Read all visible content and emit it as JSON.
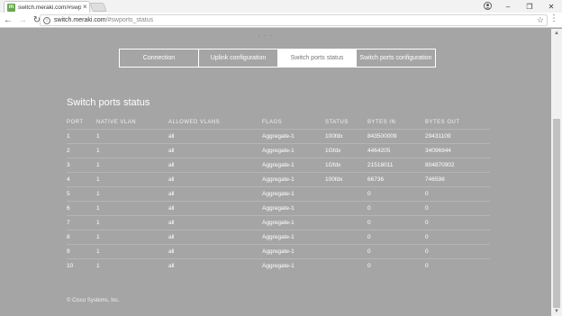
{
  "browser": {
    "tab_title": "switch.meraki.com/#swp",
    "tab_close": "×",
    "favicon_letter": "m",
    "url_host": "switch.meraki.com",
    "url_path": "/#swports_status",
    "window_controls": [
      "–",
      "❐",
      "✕"
    ]
  },
  "page": {
    "dots": "· · ·",
    "tabs": [
      {
        "label": "Connection",
        "active": false
      },
      {
        "label": "Uplink configuration",
        "active": false
      },
      {
        "label": "Switch ports status",
        "active": true
      },
      {
        "label": "Switch ports configuration",
        "active": false
      }
    ],
    "section_title": "Switch ports status",
    "columns": [
      "PORT",
      "NATIVE VLAN",
      "ALLOWED VLANS",
      "FLAGS",
      "STATUS",
      "BYTES IN",
      "BYTES OUT"
    ],
    "rows": [
      [
        "1",
        "1",
        "all",
        "Aggregate-1",
        "100fdx",
        "843500009",
        "29431109"
      ],
      [
        "2",
        "1",
        "all",
        "Aggregate-1",
        "1Gfdx",
        "4464205",
        "34096944"
      ],
      [
        "3",
        "1",
        "all",
        "Aggregate-1",
        "1Gfdx",
        "21518011",
        "804870902"
      ],
      [
        "4",
        "1",
        "all",
        "Aggregate-1",
        "100fdx",
        "66736",
        "746598"
      ],
      [
        "5",
        "1",
        "all",
        "Aggregate-1",
        "",
        "0",
        "0"
      ],
      [
        "6",
        "1",
        "all",
        "Aggregate-1",
        "",
        "0",
        "0"
      ],
      [
        "7",
        "1",
        "all",
        "Aggregate-1",
        "",
        "0",
        "0"
      ],
      [
        "8",
        "1",
        "all",
        "Aggregate-1",
        "",
        "0",
        "0"
      ],
      [
        "9",
        "1",
        "all",
        "Aggregate-1",
        "",
        "0",
        "0"
      ],
      [
        "10",
        "1",
        "all",
        "Aggregate-1",
        "",
        "0",
        "0"
      ]
    ],
    "footer": "© Cisco Systems, Inc."
  }
}
